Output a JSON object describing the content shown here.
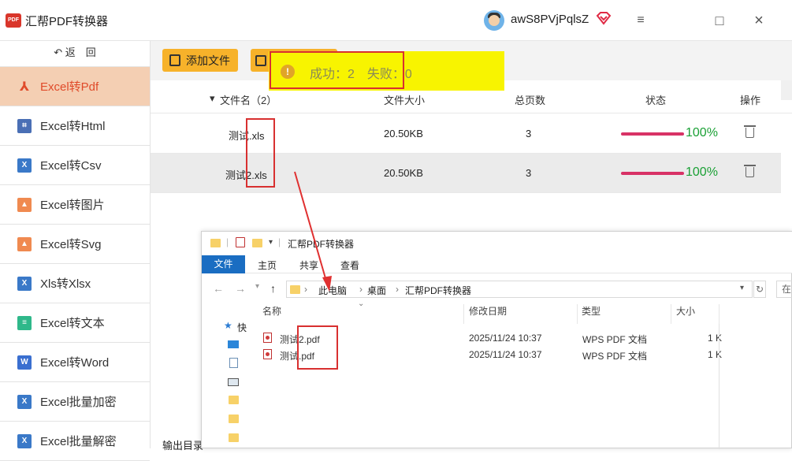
{
  "app": {
    "title": "汇帮PDF转换器",
    "logo_text": "PDF",
    "username": "awS8PVjPqlsZ"
  },
  "window_controls": {
    "menu": "≡",
    "maximize": "□",
    "close": "×"
  },
  "sidebar": {
    "back_label": "返　回",
    "items": [
      {
        "label": "Excel转Pdf",
        "icon": "pdf-icon",
        "active": true
      },
      {
        "label": "Excel转Html",
        "icon": "html-icon"
      },
      {
        "label": "Excel转Csv",
        "icon": "excel-x-icon"
      },
      {
        "label": "Excel转图片",
        "icon": "image-icon"
      },
      {
        "label": "Excel转Svg",
        "icon": "image-icon"
      },
      {
        "label": "Xls转Xlsx",
        "icon": "excel-x-icon"
      },
      {
        "label": "Excel转文本",
        "icon": "text-file-icon"
      },
      {
        "label": "Excel转Word",
        "icon": "word-icon"
      },
      {
        "label": "Excel批量加密",
        "icon": "excel-sheet-icon"
      },
      {
        "label": "Excel批量解密",
        "icon": "excel-sheet-icon"
      }
    ]
  },
  "toolbar": {
    "add_file_label": "添加文件"
  },
  "toast": {
    "text": "成功：2　失败：0"
  },
  "table": {
    "headers": {
      "name": "文件名（2）",
      "size": "文件大小",
      "pages": "总页数",
      "status": "状态",
      "actions": "操作"
    },
    "rows": [
      {
        "name": "测试.xls",
        "size": "20.50KB",
        "pages": "3",
        "progress": "100%"
      },
      {
        "name": "测试2.xls",
        "size": "20.50KB",
        "pages": "3",
        "progress": "100%"
      }
    ]
  },
  "footer": {
    "output_label": "输出目录"
  },
  "explorer": {
    "title": "汇帮PDF转换器",
    "tabs": [
      "文件",
      "主页",
      "共享",
      "查看"
    ],
    "breadcrumb": [
      "此电脑",
      "桌面",
      "汇帮PDF转换器"
    ],
    "search_placeholder": "在",
    "quick_access": "快",
    "columns": {
      "name": "名称",
      "date": "修改日期",
      "type": "类型",
      "size": "大小"
    },
    "files": [
      {
        "name": "测试2.pdf",
        "date": "2025/11/24 10:37",
        "type": "WPS PDF 文档",
        "size": "1 K"
      },
      {
        "name": "测试.pdf",
        "date": "2025/11/24 10:37",
        "type": "WPS PDF 文档",
        "size": "1 K"
      }
    ]
  },
  "colors": {
    "accent": "#f7b22a",
    "active_nav_bg": "#f4cfb3",
    "progress": "#d83266",
    "success": "#1aa035",
    "toast_bg": "#f8f400",
    "highlight": "#d83030"
  }
}
